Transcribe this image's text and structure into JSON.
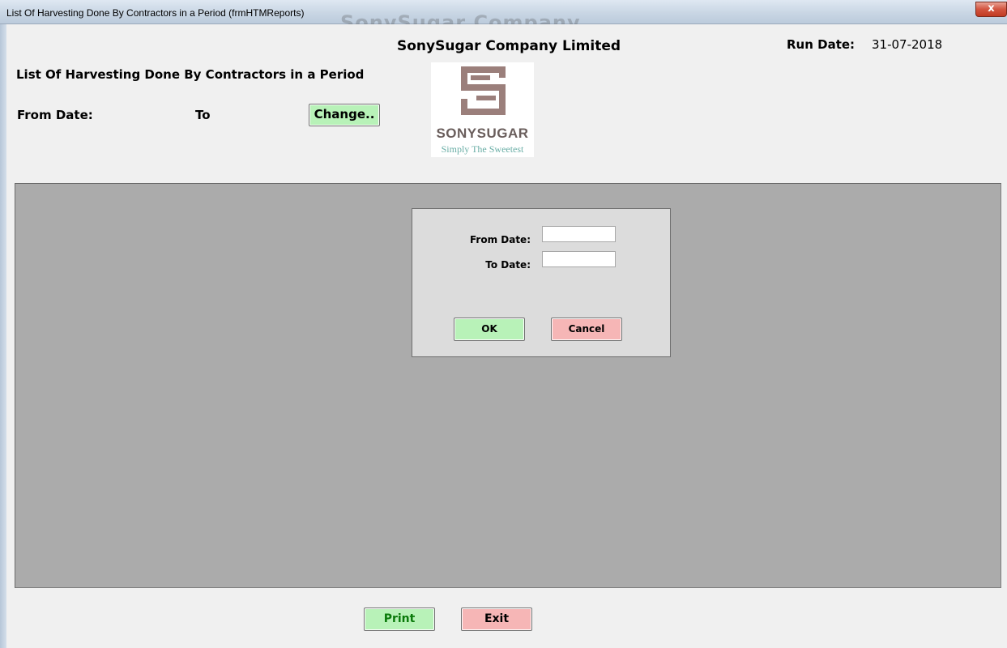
{
  "window": {
    "title": "List Of Harvesting Done By Contractors in a Period (frmHTMReports)",
    "close_glyph": "x"
  },
  "header": {
    "company": "SonySugar Company Limited",
    "run_date_label": "Run Date:",
    "run_date_value": "31-07-2018",
    "report_title": "List Of Harvesting Done By Contractors in a Period",
    "from_date_label": "From Date:",
    "to_label": "To",
    "change_button": "Change.."
  },
  "logo": {
    "brand_text": "SONYSUGAR",
    "tagline": "Simply The Sweetest",
    "color": "#9b7f7b"
  },
  "dialog": {
    "from_date_label": "From Date:",
    "from_date_value": "",
    "to_date_label": "To Date:",
    "to_date_value": "",
    "ok_button": "OK",
    "cancel_button": "Cancel"
  },
  "footer": {
    "print_button": "Print",
    "exit_button": "Exit"
  },
  "colors": {
    "green_button": "#b8f2b8",
    "red_button": "#f6b6b6",
    "panel_grey": "#ababab",
    "dialog_grey": "#dcdcdc"
  }
}
